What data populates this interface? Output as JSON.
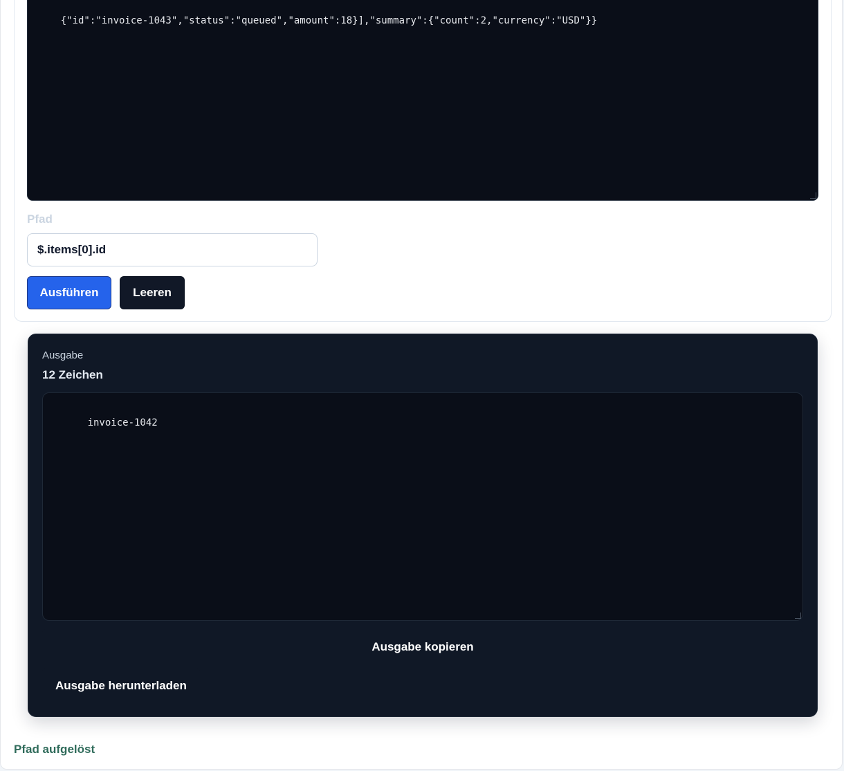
{
  "input": {
    "json_text": "{\"id\":\"invoice-1043\",\"status\":\"queued\",\"amount\":18}],\"summary\":{\"count\":2,\"currency\":\"USD\"}}"
  },
  "path": {
    "label": "Pfad",
    "value": "$.items[0].id"
  },
  "actions": {
    "run_label": "Ausführen",
    "clear_label": "Leeren"
  },
  "output": {
    "label": "Ausgabe",
    "char_count": "12 Zeichen",
    "result_text": "invoice-1042",
    "copy_label": "Ausgabe kopieren",
    "download_label": "Ausgabe herunterladen"
  },
  "status": {
    "message": "Pfad aufgelöst",
    "color": "#2f6b5a"
  },
  "colors": {
    "primary": "#2563eb",
    "dark_button": "#111827",
    "code_background": "#0a0e18",
    "output_panel": "#101826"
  }
}
